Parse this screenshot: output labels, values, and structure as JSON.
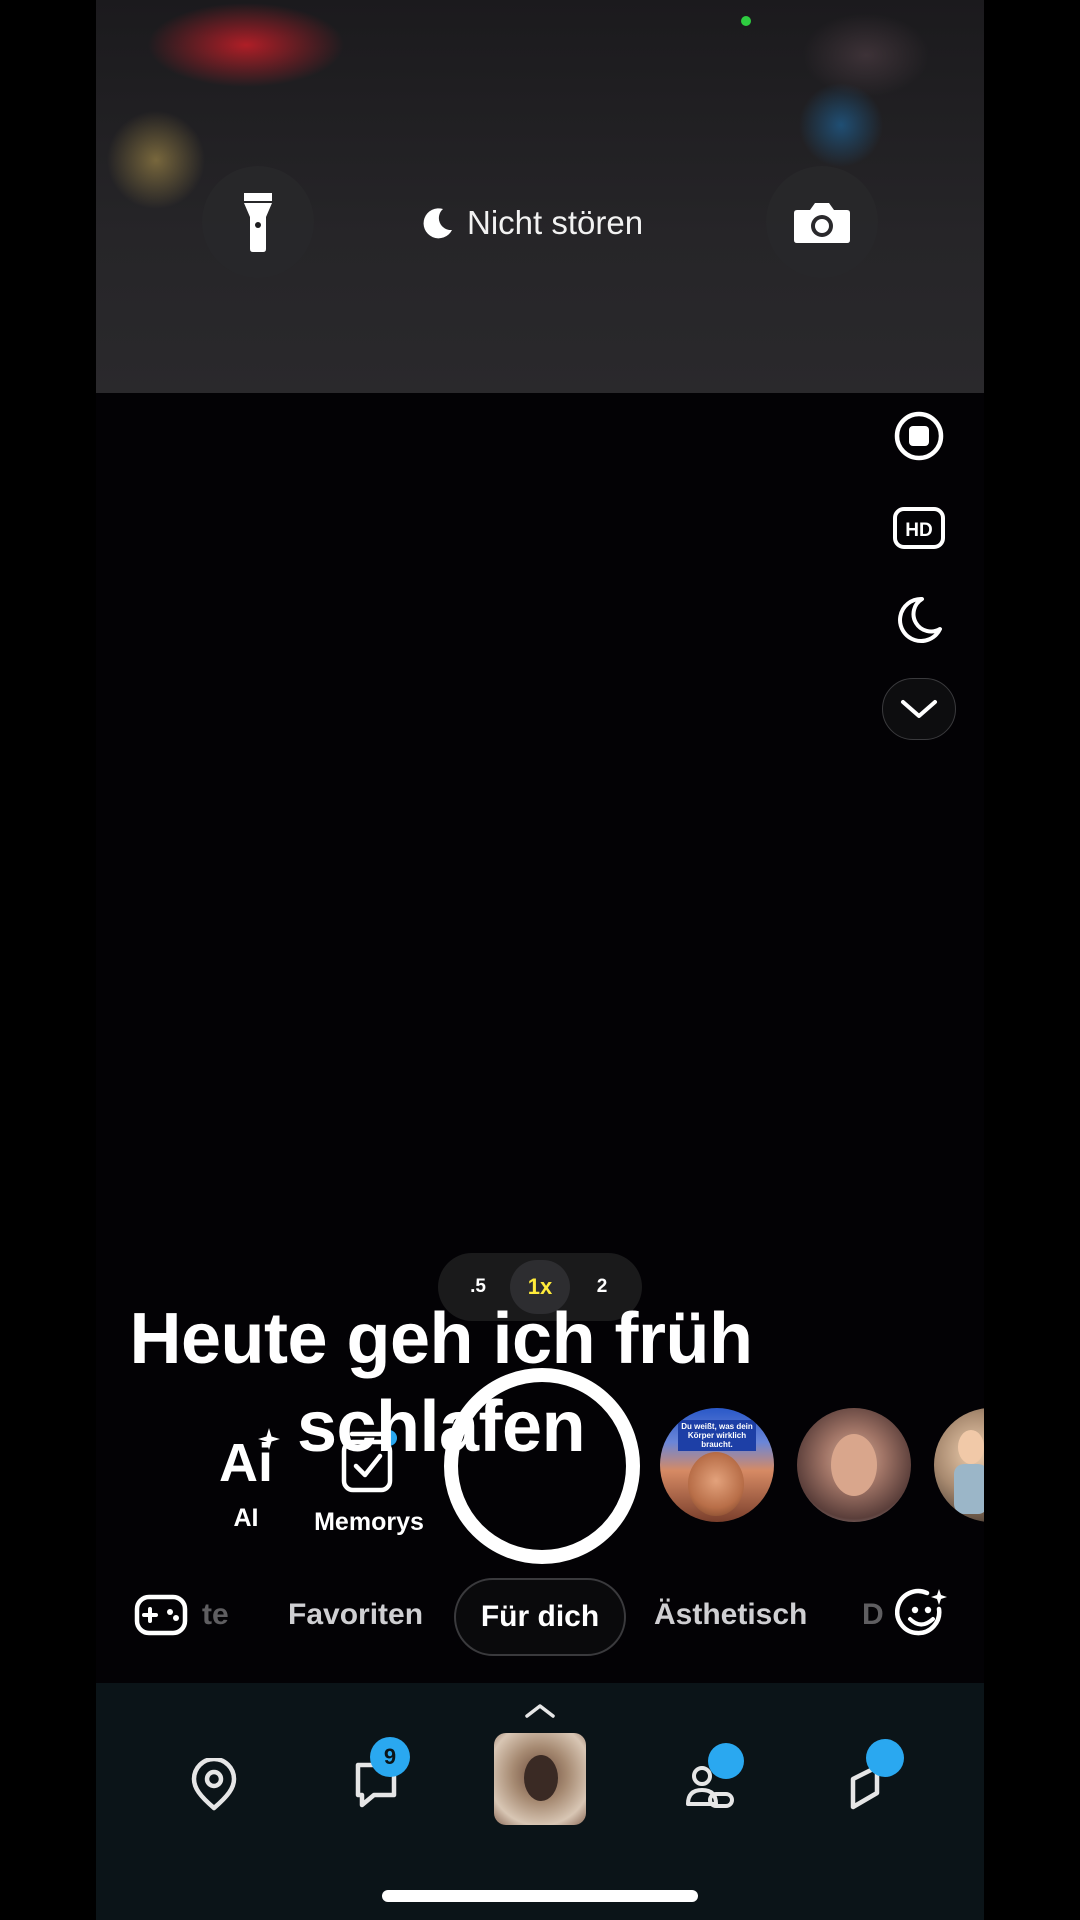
{
  "top": {
    "dnd_label": "Nicht stören"
  },
  "side_tools": [
    "stop-icon",
    "hd-icon",
    "night-mode-icon",
    "chevron-down-icon"
  ],
  "zoom": {
    "options": [
      ".5",
      "1x",
      "2"
    ],
    "selected": "1x"
  },
  "caption": "Heute geh ich früh schlafen",
  "tools": {
    "ai_glyph": "Ai",
    "ai_label": "AI",
    "memories_label": "Memorys"
  },
  "lens_thumb": {
    "text": "Du weißt, was dein Körper wirklich braucht."
  },
  "categories": {
    "partial_left": "te",
    "favorites": "Favoriten",
    "for_you": "Für dich",
    "aesthetic": "Ästhetisch",
    "partial_right": "D"
  },
  "nav": {
    "chat_badge": "9"
  },
  "colors": {
    "accent_blue": "#2aa8f0",
    "zoom_active": "#ffeb3b",
    "nav_bg": "#0b1418"
  }
}
